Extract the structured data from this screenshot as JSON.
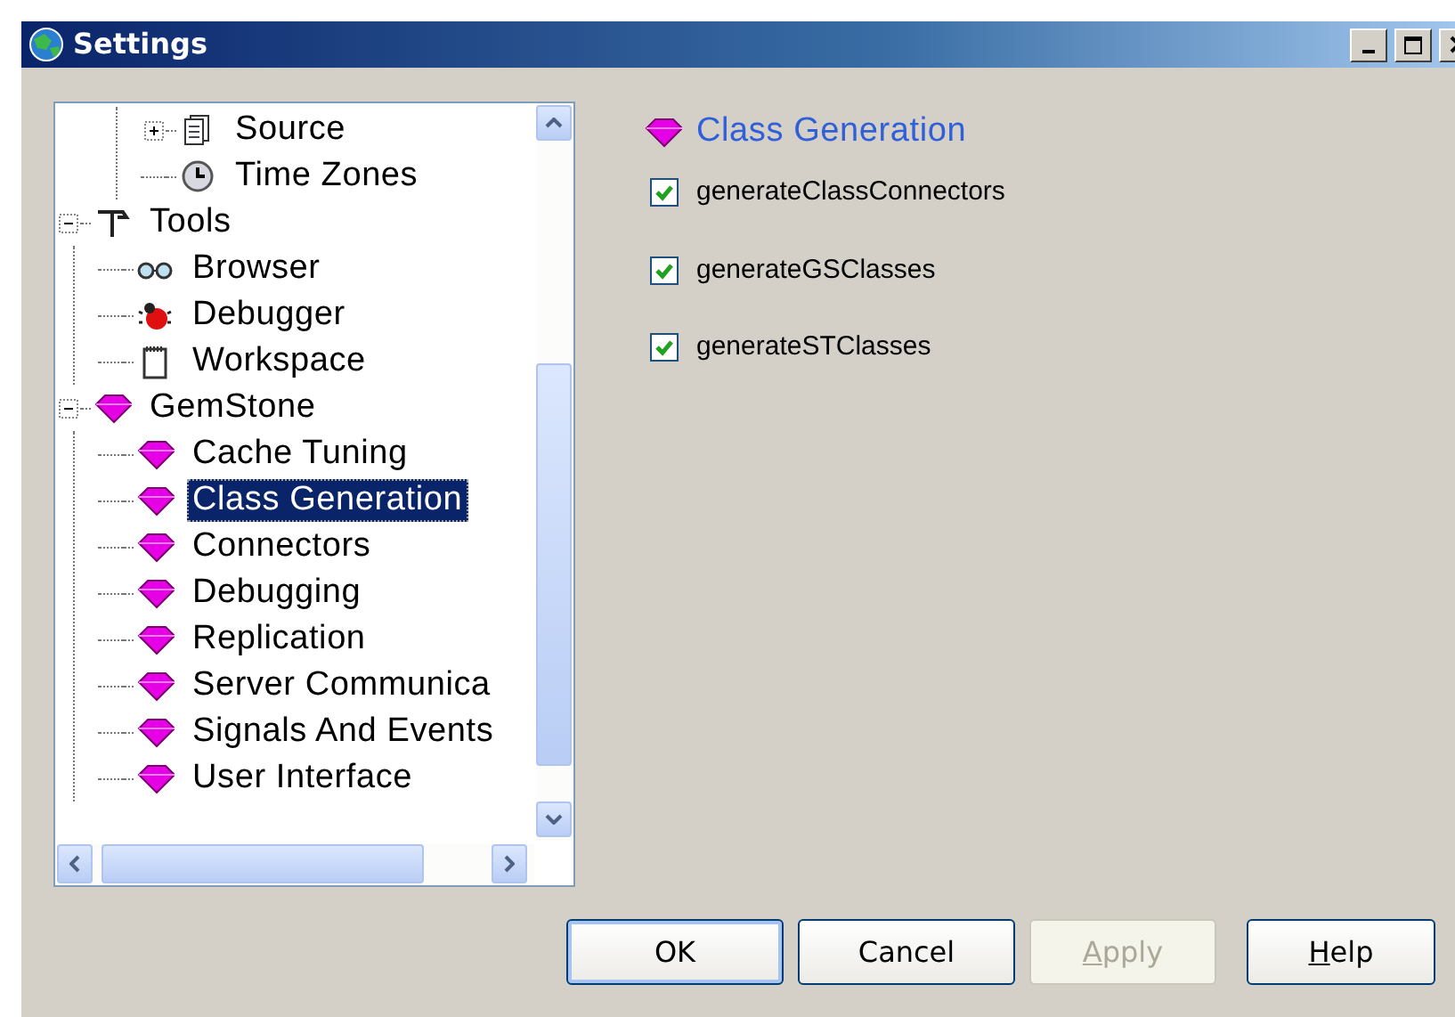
{
  "window": {
    "title": "Settings"
  },
  "tree": {
    "items": [
      {
        "children": [
          {
            "label": "Source",
            "kind": "source",
            "expanded": false,
            "selected": false
          },
          {
            "label": "Time Zones",
            "kind": "clock",
            "selected": false
          }
        ]
      },
      {
        "label": "Tools",
        "kind": "tools",
        "expanded": true,
        "selected": false,
        "children": [
          {
            "label": "Browser",
            "kind": "browser",
            "selected": false
          },
          {
            "label": "Debugger",
            "kind": "debugger",
            "selected": false
          },
          {
            "label": "Workspace",
            "kind": "workspace",
            "selected": false
          }
        ]
      },
      {
        "label": "GemStone",
        "kind": "gem",
        "expanded": true,
        "selected": false,
        "children": [
          {
            "label": "Cache Tuning",
            "kind": "gem",
            "selected": false
          },
          {
            "label": "Class Generation",
            "kind": "gem",
            "selected": true
          },
          {
            "label": "Connectors",
            "kind": "gem",
            "selected": false
          },
          {
            "label": "Debugging",
            "kind": "gem",
            "selected": false
          },
          {
            "label": "Replication",
            "kind": "gem",
            "selected": false
          },
          {
            "label": "Server Communica",
            "kind": "gem",
            "selected": false
          },
          {
            "label": "Signals And Events",
            "kind": "gem",
            "selected": false
          },
          {
            "label": "User Interface",
            "kind": "gem",
            "selected": false
          }
        ]
      }
    ]
  },
  "panel": {
    "title": "Class Generation",
    "options": [
      {
        "label": "generateClassConnectors",
        "checked": true
      },
      {
        "label": "generateGSClasses",
        "checked": true
      },
      {
        "label": "generateSTClasses",
        "checked": true
      }
    ]
  },
  "buttons": [
    {
      "label": "OK",
      "default": true,
      "disabled": false,
      "mnemonic": false
    },
    {
      "label": "Cancel",
      "default": false,
      "disabled": false,
      "mnemonic": false
    },
    {
      "label": "Apply",
      "default": false,
      "disabled": true,
      "mnemonic": true
    },
    {
      "label": "Help",
      "default": false,
      "disabled": false,
      "mnemonic": true
    }
  ]
}
